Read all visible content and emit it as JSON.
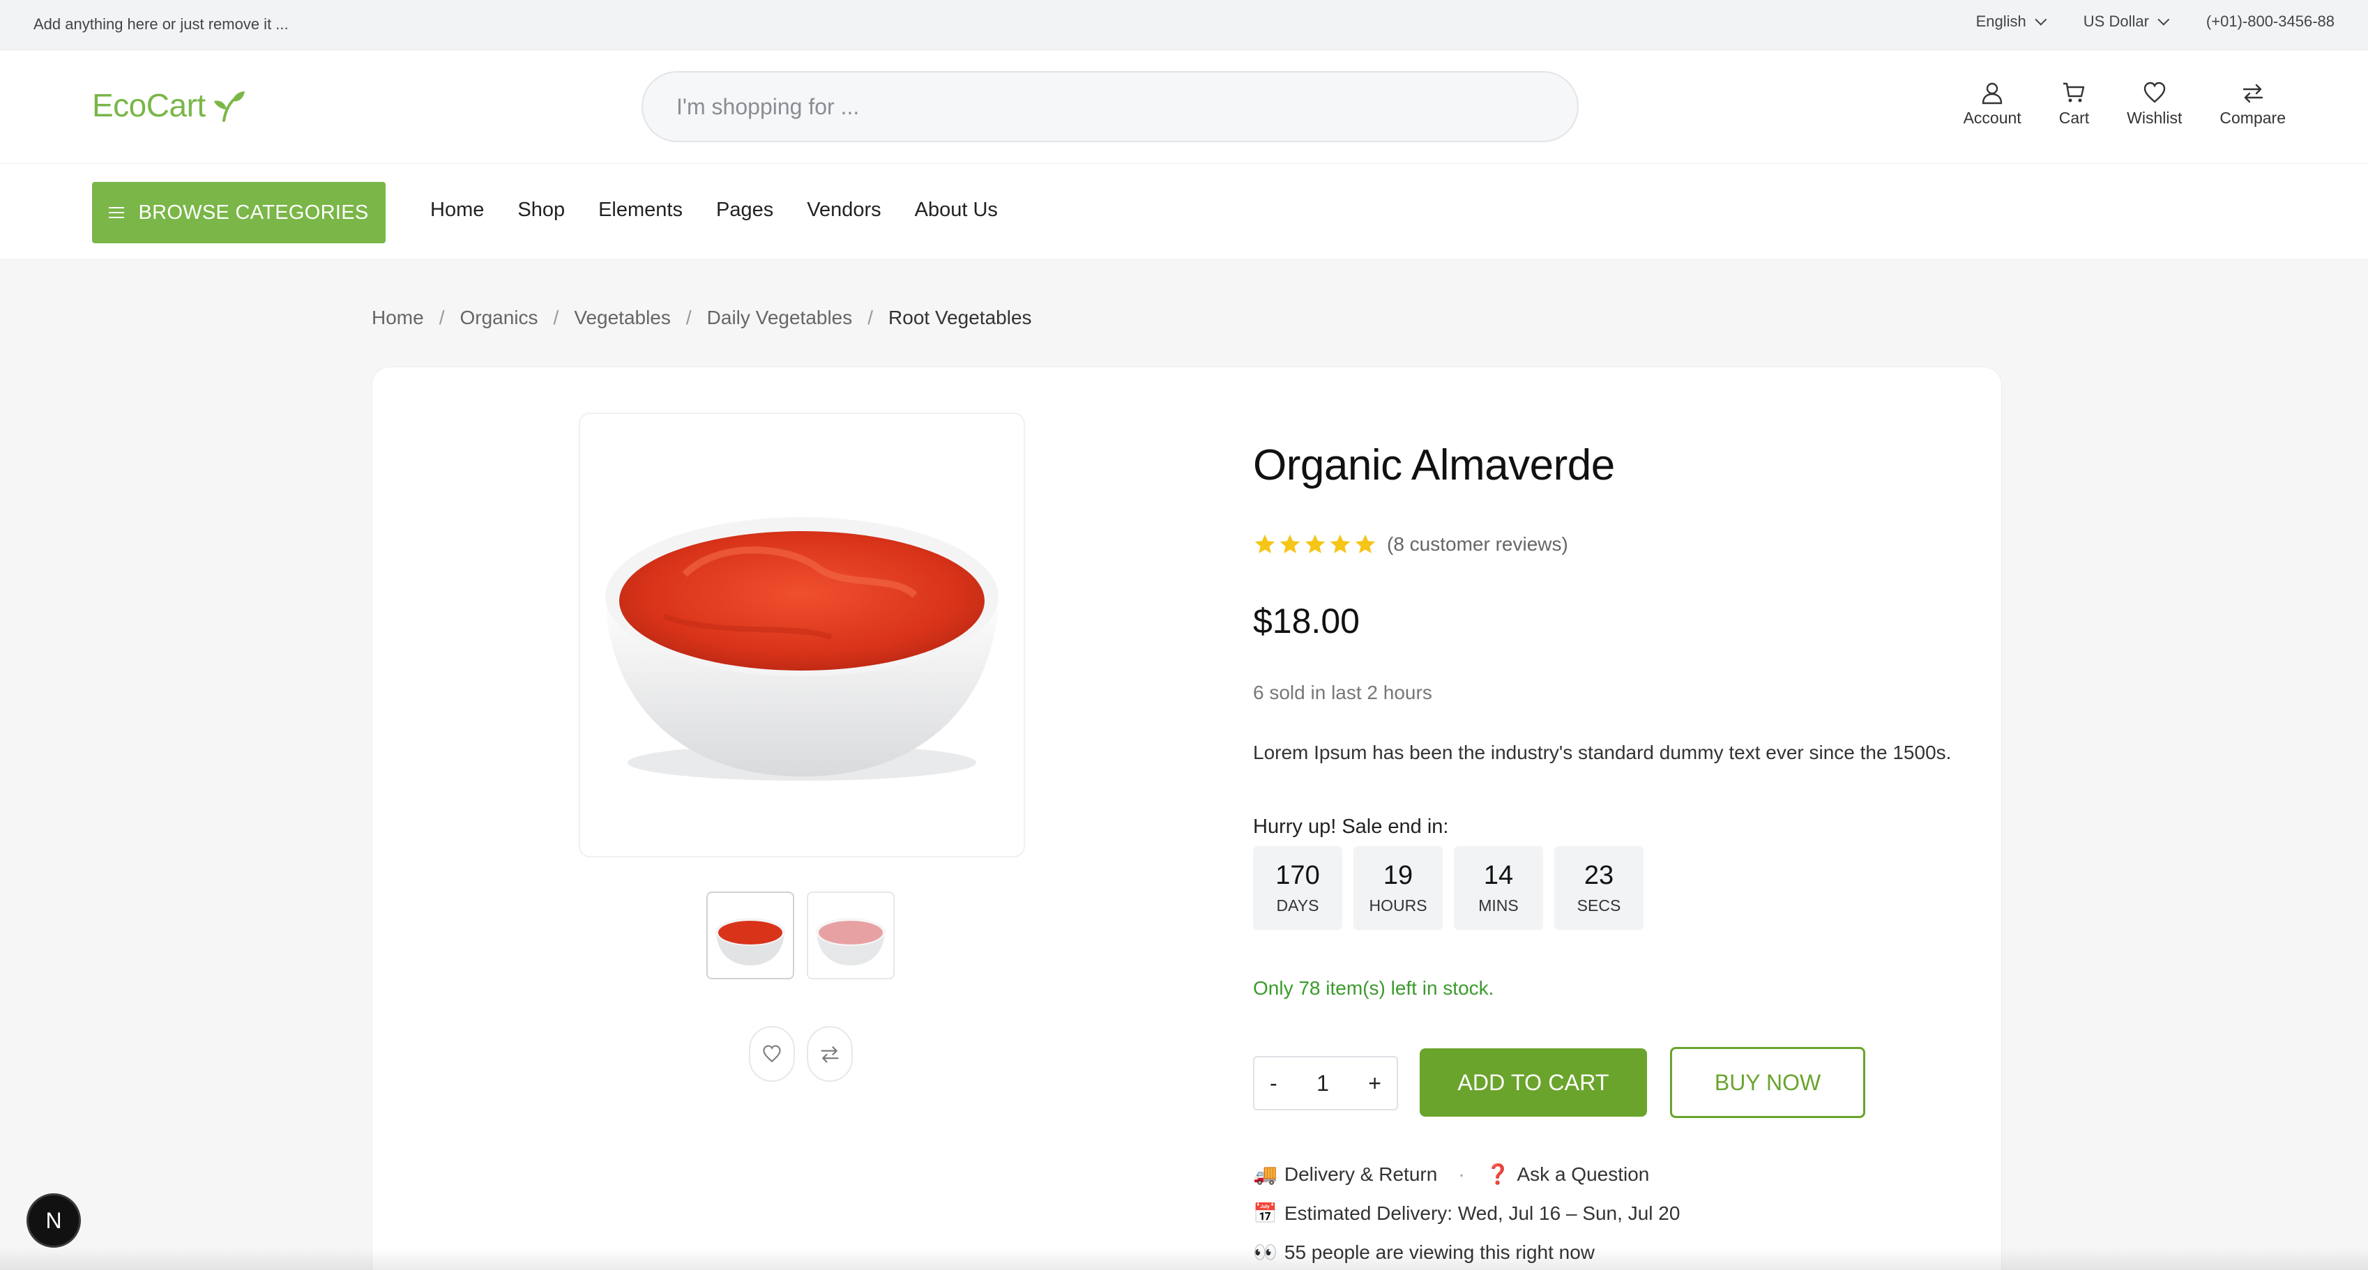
{
  "topbar": {
    "promo": "Add anything here or just remove it ...",
    "language": "English",
    "currency": "US Dollar",
    "phone": "(+01)-800-3456-88"
  },
  "header": {
    "logo_text": "EcoCart",
    "search_placeholder": "I'm shopping for ...",
    "icons": [
      {
        "label": "Account",
        "icon": "user-icon"
      },
      {
        "label": "Cart",
        "icon": "cart-icon"
      },
      {
        "label": "Wishlist",
        "icon": "heart-icon"
      },
      {
        "label": "Compare",
        "icon": "compare-icon"
      }
    ]
  },
  "nav": {
    "browse_label": "BROWSE CATEGORIES",
    "links": [
      "Home",
      "Shop",
      "Elements",
      "Pages",
      "Vendors",
      "About Us"
    ]
  },
  "breadcrumb": [
    "Home",
    "Organics",
    "Vegetables",
    "Daily Vegetables",
    "Root Vegetables"
  ],
  "product": {
    "title": "Organic Almaverde",
    "rating": 5,
    "reviews": "(8 customer reviews)",
    "price": "$18.00",
    "sold": "6 sold in last 2 hours",
    "description": "Lorem Ipsum has been the industry's standard dummy text ever since the 1500s.",
    "hurry": "Hurry up! Sale end in:",
    "countdown": [
      {
        "value": "170",
        "label": "DAYS"
      },
      {
        "value": "19",
        "label": "HOURS"
      },
      {
        "value": "14",
        "label": "MINS"
      },
      {
        "value": "23",
        "label": "SECS"
      }
    ],
    "stock": "Only 78 item(s) left in stock.",
    "quantity": "1",
    "qty_minus": "-",
    "qty_plus": "+",
    "add_to_cart": "ADD TO CART",
    "buy_now": "BUY NOW",
    "delivery_return": "Delivery & Return",
    "ask_question": "Ask a Question",
    "estimated_delivery": "Estimated Delivery: Wed, Jul 16 – Sun, Jul 20",
    "viewing": "55 people are viewing this right now",
    "emoji": {
      "truck": "🚚",
      "question": "❓",
      "calendar": "📅",
      "eyes": "👀"
    }
  },
  "badge": "N",
  "colors": {
    "brand": "#7ab648",
    "cart_button": "#6aa42c",
    "stock": "#3a9b2c",
    "star": "#f5c518"
  }
}
